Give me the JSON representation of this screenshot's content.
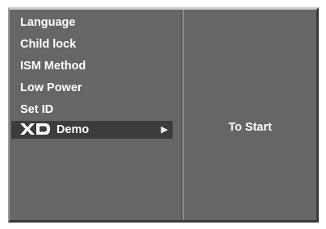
{
  "menu": {
    "items": [
      {
        "label": "Language"
      },
      {
        "label": "Child lock"
      },
      {
        "label": "ISM Method"
      },
      {
        "label": "Low Power"
      },
      {
        "label": "Set ID"
      },
      {
        "label": "Demo",
        "logo": "XD",
        "selected": true,
        "arrow": "▶"
      }
    ]
  },
  "submenu": {
    "hint": "To Start"
  },
  "colors": {
    "panel": "#666666",
    "selected": "#3c3c3c",
    "text": "#ffffff"
  }
}
